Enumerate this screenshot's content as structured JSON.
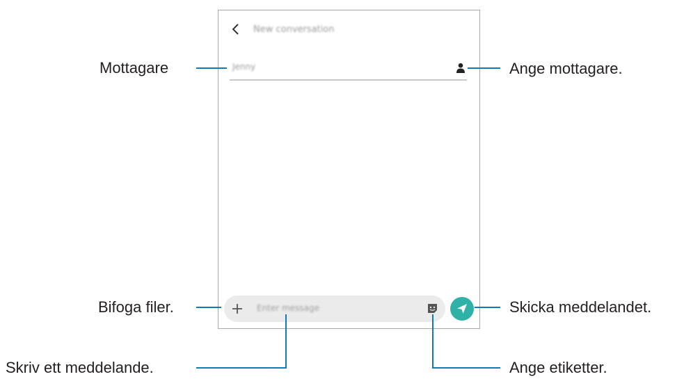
{
  "screen": {
    "header_title": "New conversation",
    "recipient_value": "Jenny",
    "message_placeholder": "Enter message"
  },
  "callouts": {
    "recipient_field": "Mottagare",
    "add_recipient": "Ange mottagare.",
    "attach_files": "Bifoga filer.",
    "send_message": "Skicka meddelandet.",
    "write_message": "Skriv ett meddelande.",
    "add_stickers": "Ange etiketter."
  },
  "colors": {
    "callout_line": "#0f7ab5",
    "send_button": "#30b1a8",
    "input_bar": "#ebebeb"
  },
  "icons": [
    "back-arrow-icon",
    "contact-person-icon",
    "plus-icon",
    "sticker-icon",
    "send-icon"
  ]
}
